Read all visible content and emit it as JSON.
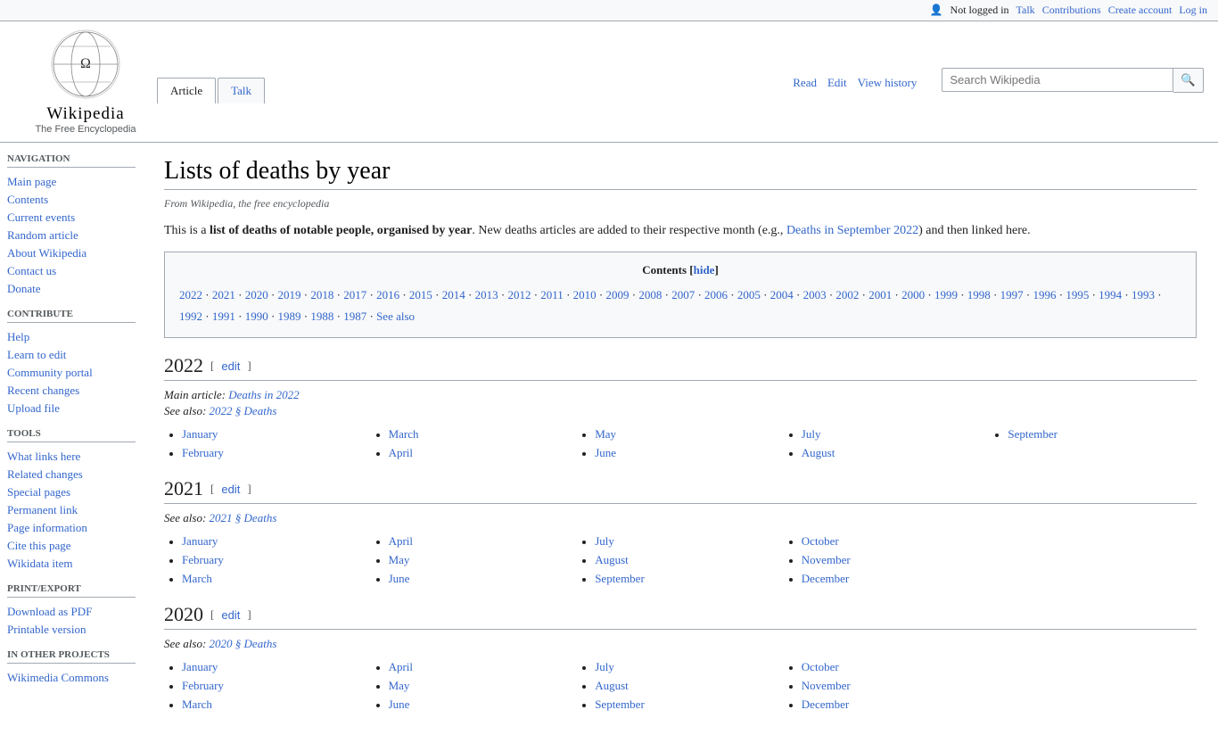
{
  "topbar": {
    "not_logged_in": "Not logged in",
    "talk": "Talk",
    "contributions": "Contributions",
    "create_account": "Create account",
    "log_in": "Log in"
  },
  "logo": {
    "title": "Wikipedia",
    "subtitle": "The Free Encyclopedia"
  },
  "tabs": {
    "article": "Article",
    "talk": "Talk",
    "read": "Read",
    "edit": "Edit",
    "view_history": "View history"
  },
  "search": {
    "placeholder": "Search Wikipedia"
  },
  "sidebar": {
    "navigation_title": "Navigation",
    "navigation_items": [
      {
        "label": "Main page",
        "href": "#"
      },
      {
        "label": "Contents",
        "href": "#"
      },
      {
        "label": "Current events",
        "href": "#"
      },
      {
        "label": "Random article",
        "href": "#"
      },
      {
        "label": "About Wikipedia",
        "href": "#"
      },
      {
        "label": "Contact us",
        "href": "#"
      },
      {
        "label": "Donate",
        "href": "#"
      }
    ],
    "contribute_title": "Contribute",
    "contribute_items": [
      {
        "label": "Help",
        "href": "#"
      },
      {
        "label": "Learn to edit",
        "href": "#"
      },
      {
        "label": "Community portal",
        "href": "#"
      },
      {
        "label": "Recent changes",
        "href": "#"
      },
      {
        "label": "Upload file",
        "href": "#"
      }
    ],
    "tools_title": "Tools",
    "tools_items": [
      {
        "label": "What links here",
        "href": "#"
      },
      {
        "label": "Related changes",
        "href": "#"
      },
      {
        "label": "Special pages",
        "href": "#"
      },
      {
        "label": "Permanent link",
        "href": "#"
      },
      {
        "label": "Page information",
        "href": "#"
      },
      {
        "label": "Cite this page",
        "href": "#"
      },
      {
        "label": "Wikidata item",
        "href": "#"
      }
    ],
    "print_title": "Print/export",
    "print_items": [
      {
        "label": "Download as PDF",
        "href": "#"
      },
      {
        "label": "Printable version",
        "href": "#"
      }
    ],
    "other_title": "In other projects",
    "other_items": [
      {
        "label": "Wikimedia Commons",
        "href": "#"
      }
    ]
  },
  "page": {
    "title": "Lists of deaths by year",
    "from_wikipedia": "From Wikipedia, the free encyclopedia",
    "intro": "This is a list of deaths of notable people, organised by year. New deaths articles are added to their respective month (e.g., Deaths in September 2022) and then linked here.",
    "intro_bold": "list of deaths of notable people, organised by year",
    "intro_link_text": "Deaths in September 2022",
    "contents_title": "Contents",
    "contents_hide": "hide",
    "contents_years": [
      "2022",
      "2021",
      "2020",
      "2019",
      "2018",
      "2017",
      "2016",
      "2015",
      "2014",
      "2013",
      "2012",
      "2011",
      "2010",
      "2009",
      "2008",
      "2007",
      "2006",
      "2005",
      "2004",
      "2003",
      "2002",
      "2001",
      "2000",
      "1999",
      "1998",
      "1997",
      "1996",
      "1995",
      "1994",
      "1993",
      "1992",
      "1991",
      "1990",
      "1989",
      "1988",
      "1987"
    ],
    "contents_see_also": "See also",
    "sections": [
      {
        "year": "2022",
        "main_article_label": "Main article:",
        "main_article_text": "Deaths in 2022",
        "see_also_label": "See also:",
        "see_also_text": "2022 § Deaths",
        "months_cols": [
          [
            "January",
            "February"
          ],
          [
            "March",
            "April"
          ],
          [
            "May",
            "June"
          ],
          [
            "July",
            "August"
          ],
          [
            "September"
          ]
        ]
      },
      {
        "year": "2021",
        "see_also_label": "See also:",
        "see_also_text": "2021 § Deaths",
        "months_cols": [
          [
            "January",
            "February",
            "March"
          ],
          [
            "April",
            "May",
            "June"
          ],
          [
            "July",
            "August",
            "September"
          ],
          [
            "October",
            "November",
            "December"
          ],
          []
        ]
      },
      {
        "year": "2020",
        "see_also_label": "See also:",
        "see_also_text": "2020 § Deaths",
        "months_cols": [
          [
            "January",
            "February",
            "March"
          ],
          [
            "April",
            "May",
            "June"
          ],
          [
            "July",
            "August",
            "September"
          ],
          [
            "October",
            "November",
            "December"
          ],
          []
        ]
      }
    ]
  }
}
